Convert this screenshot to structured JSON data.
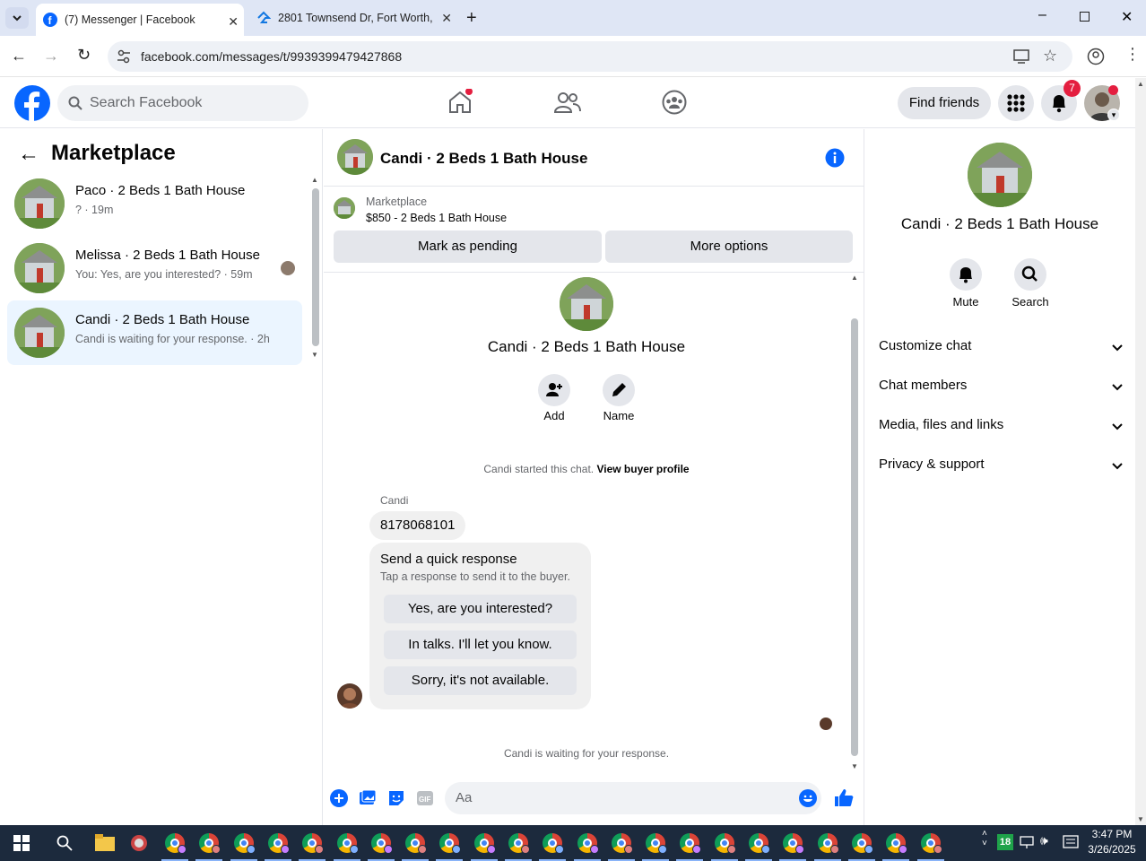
{
  "browser": {
    "tabs": [
      {
        "title": "(7) Messenger | Facebook",
        "active": true
      },
      {
        "title": "2801 Townsend Dr, Fort Worth,",
        "active": false
      }
    ],
    "url": "facebook.com/messages/t/9939399479427868"
  },
  "fb_header": {
    "search_placeholder": "Search Facebook",
    "find_friends": "Find friends",
    "notification_count": "7"
  },
  "left_panel": {
    "title": "Marketplace",
    "conversations": [
      {
        "name": "Paco · 2 Beds 1 Bath House",
        "sub": "? · 19m"
      },
      {
        "name": "Melissa · 2 Beds 1 Bath House",
        "sub": "You: Yes, are you interested? · 59m"
      },
      {
        "name": "Candi · 2 Beds 1 Bath House",
        "sub": "Candi is waiting for your response. · 2h",
        "selected": true
      }
    ]
  },
  "chat": {
    "title": "Candi · 2 Beds 1 Bath House",
    "listing": {
      "label": "Marketplace",
      "detail": "$850 - 2 Beds 1 Bath House"
    },
    "mark_pending": "Mark as pending",
    "more_options": "More options",
    "profile_name": "Candi · 2 Beds 1 Bath House",
    "add_label": "Add",
    "name_label": "Name",
    "started_text": "Candi started this chat.",
    "view_buyer": "View buyer profile",
    "sender": "Candi",
    "message": "8178068101",
    "quick_title": "Send a quick response",
    "quick_sub": "Tap a response to send it to the buyer.",
    "quick_responses": [
      "Yes, are you interested?",
      "In talks. I'll let you know.",
      "Sorry, it's not available."
    ],
    "waiting_text": "Candi is waiting for your response.",
    "composer_placeholder": "Aa"
  },
  "right_panel": {
    "name": "Candi · 2 Beds 1 Bath House",
    "mute": "Mute",
    "search": "Search",
    "sections": [
      "Customize chat",
      "Chat members",
      "Media, files and links",
      "Privacy & support"
    ]
  },
  "taskbar": {
    "time": "3:47 PM",
    "date": "3/26/2025"
  },
  "colors": {
    "fb_blue": "#0866ff",
    "selected_bg": "#ebf5ff",
    "badge_red": "#e41e3f"
  }
}
